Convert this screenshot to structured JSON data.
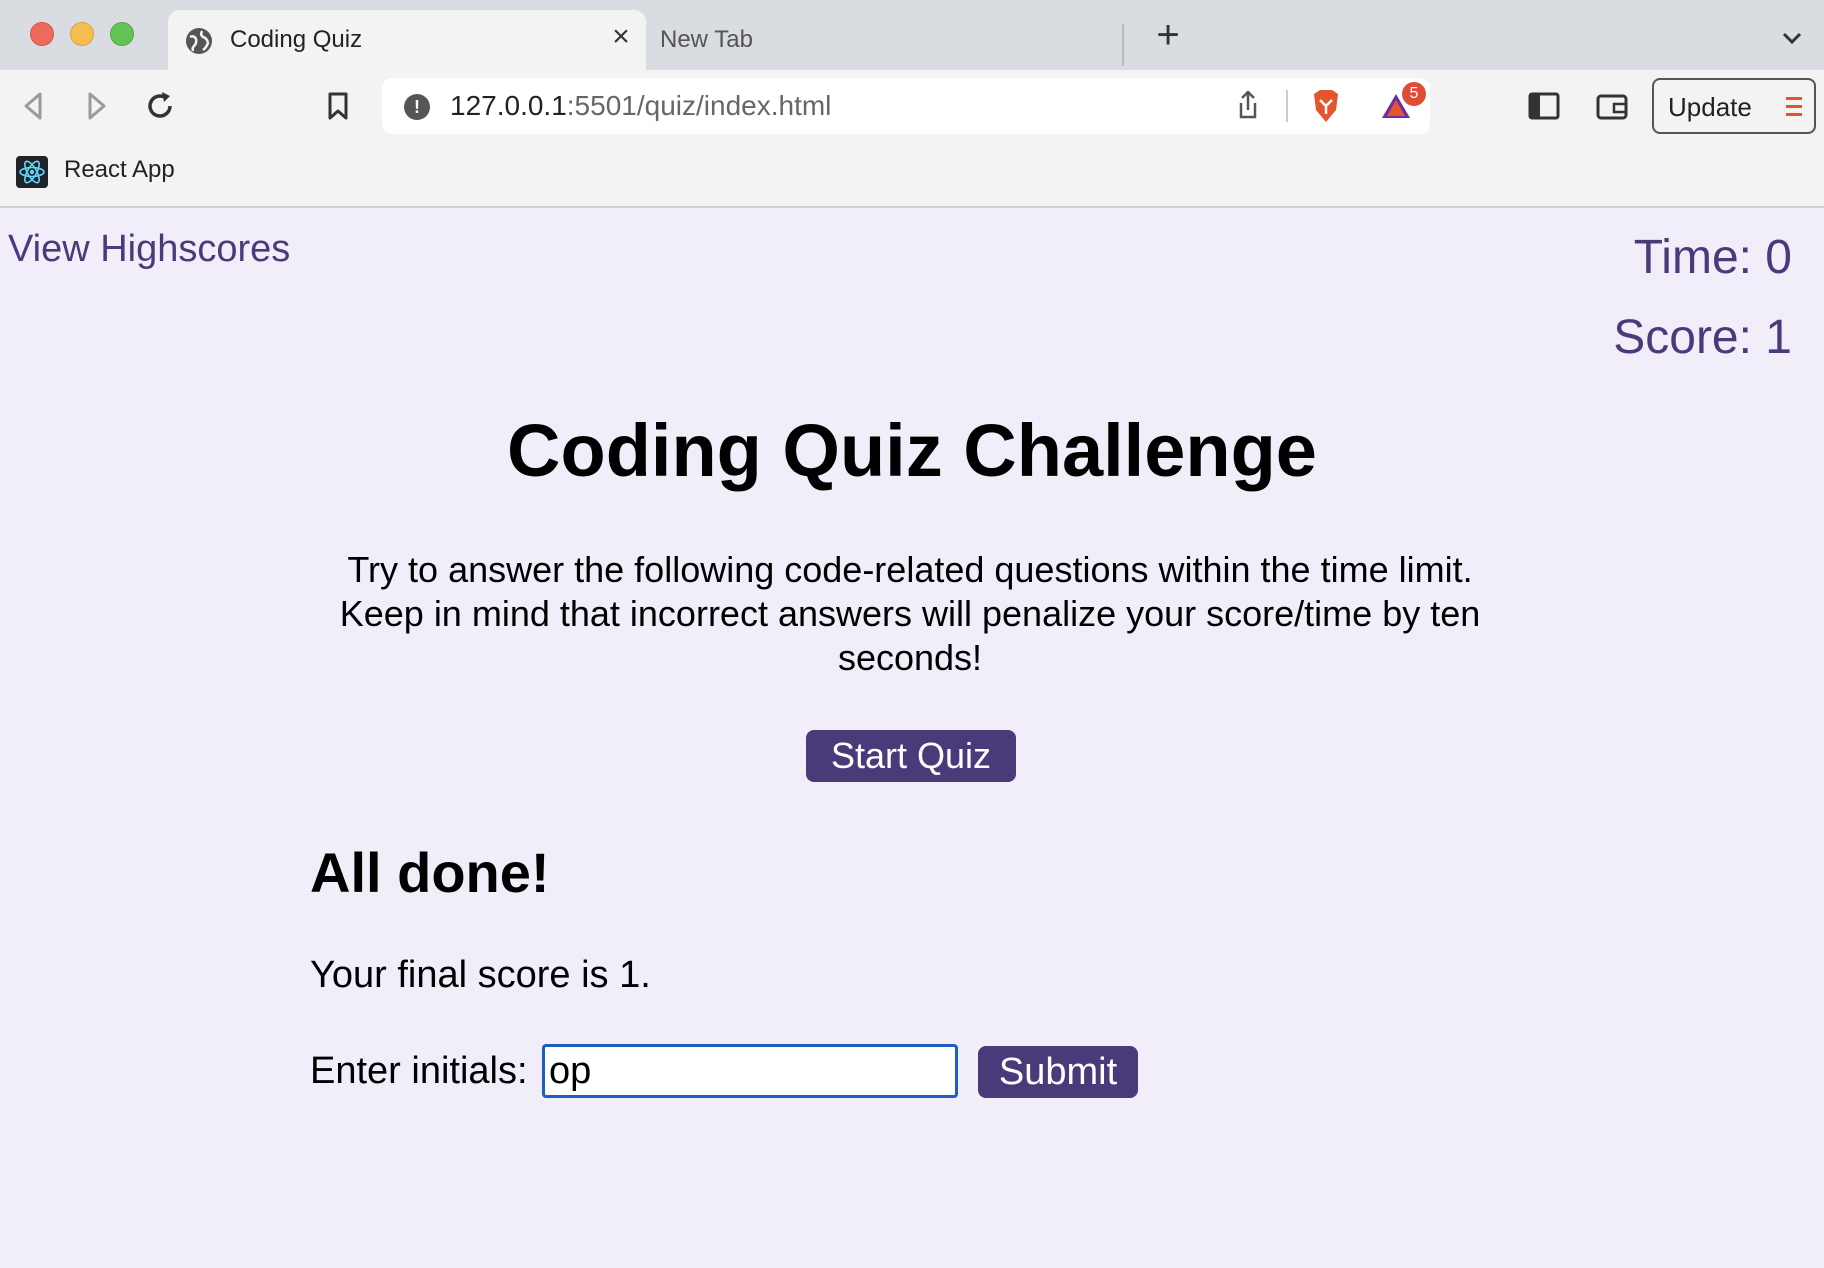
{
  "browser": {
    "tabs": [
      {
        "title": "Coding Quiz",
        "active": true
      },
      {
        "title": "New Tab",
        "active": false
      }
    ],
    "url": {
      "host": "127.0.0.1",
      "path": ":5501/quiz/index.html"
    },
    "extension_badge": "5",
    "update_label": "Update",
    "bookmarks": [
      {
        "label": "React App",
        "icon": "react-icon"
      }
    ],
    "icons": [
      "globe-icon",
      "close-icon",
      "plus-icon",
      "chevron-down-icon",
      "back-icon",
      "forward-icon",
      "reload-icon",
      "bookmark-icon",
      "info-icon",
      "share-icon",
      "brave-shield-icon",
      "brave-rewards-icon",
      "sidebar-icon",
      "wallet-icon",
      "menu-icon"
    ],
    "colors": {
      "accent": "#4b3a7a",
      "page_bg": "#f1eef9",
      "badge": "#e04b36",
      "brave": "#e2552f"
    }
  },
  "page": {
    "highscores_link": "View Highscores",
    "time": "Time: 0",
    "score": "Score: 1",
    "title": "Coding Quiz Challenge",
    "intro": "Try to answer the following code-related questions within the time limit. Keep in mind that incorrect answers will penalize your score/time by ten seconds!",
    "start_button": "Start Quiz",
    "done_title": "All done!",
    "final_score": "Your final score is 1.",
    "initials_label": "Enter initials:",
    "initials_value": "op",
    "submit_button": "Submit"
  }
}
